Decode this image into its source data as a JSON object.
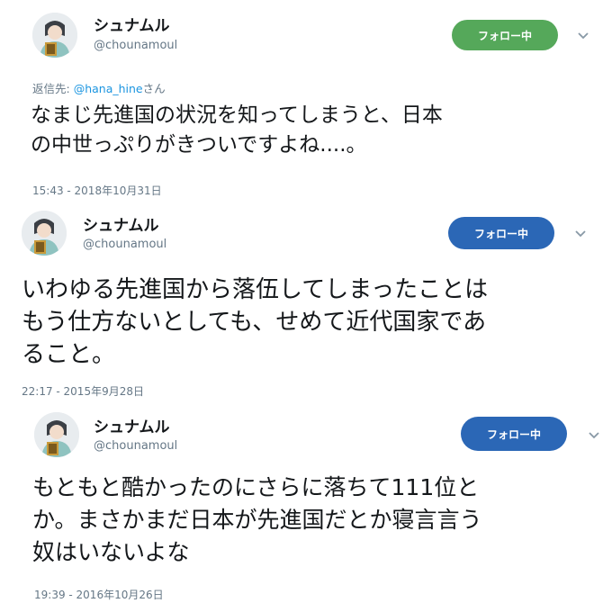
{
  "tweets": [
    {
      "name": "シュナムル",
      "handle": "@chounamoul",
      "follow_label": "フォロー中",
      "reply_prefix": "返信先: ",
      "reply_user": "@hana_hine",
      "reply_suffix": "さん",
      "text": "なまじ先進国の状況を知ってしまうと、日本\nの中世っぷりがきついですよね....。",
      "timestamp": "15:43 - 2018年10月31日"
    },
    {
      "name": "シュナムル",
      "handle": "@chounamoul",
      "follow_label": "フォロー中",
      "text": "いわゆる先進国から落伍してしまったことは\nもう仕方ないとしても、せめて近代国家であ\nること。",
      "timestamp": "22:17 - 2015年9月28日"
    },
    {
      "name": "シュナムル",
      "handle": "@chounamoul",
      "follow_label": "フォロー中",
      "text": "もともと酷かったのにさらに落ちて111位と\nか。まさかまだ日本が先進国だとか寝言言う\n奴はいないよな",
      "timestamp": "19:39 - 2016年10月26日"
    }
  ],
  "colors": {
    "follow_green": "#55a85a",
    "follow_blue": "#2b67b6",
    "link": "#1b95e0",
    "secondary_text": "#657786"
  },
  "icons": [
    "avatar-image",
    "chevron-down-icon"
  ]
}
